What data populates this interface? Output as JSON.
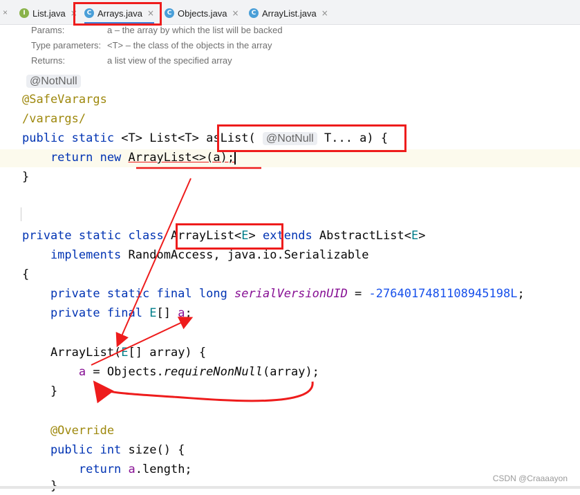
{
  "tabs": [
    {
      "label": "List.java",
      "icon": "I"
    },
    {
      "label": "Arrays.java",
      "icon": "C"
    },
    {
      "label": "Objects.java",
      "icon": "C"
    },
    {
      "label": "ArrayList.java",
      "icon": "C"
    }
  ],
  "tab_close_glyph": "×",
  "doc": {
    "params_key": "Params:",
    "params_val": "a – the array by which the list will be backed",
    "type_params_key": "Type parameters:",
    "type_params_val": "<T> – the class of the objects in the array",
    "returns_key": "Returns:",
    "returns_val": "a list view of the specified array"
  },
  "code": {
    "l1": "@NotNull",
    "l2": "@SafeVarargs",
    "l3": "/varargs/",
    "l4_a": "public static ",
    "l4_b": "<T> List<T> ",
    "l4_c": "asList(",
    "l4_hint": "@NotNull",
    "l4_d": "T... a) {",
    "l5_a": "    return new ",
    "l5_b": "ArrayList<>(a);",
    "l6": "}",
    "l7_a": "private static class ",
    "l7_b": "ArrayList<",
    "l7_c": "E",
    "l7_d": "> ",
    "l7_e": "extends ",
    "l7_f": "AbstractList<",
    "l7_g": "E",
    "l7_h": ">",
    "l8_a": "    implements ",
    "l8_b": "RandomAccess, java.io.Serializable",
    "l9": "{",
    "l10_a": "    private static final long ",
    "l10_b": "serialVersionUID",
    "l10_c": " = ",
    "l10_d": "-2764017481108945198L",
    "l10_e": ";",
    "l11_a": "    private final ",
    "l11_b": "E",
    "l11_c": "[] ",
    "l11_d": "a",
    "l11_e": ";",
    "l12_a": "    ArrayList(",
    "l12_b": "E",
    "l12_c": "[] array) {",
    "l13_a": "        ",
    "l13_b": "a",
    "l13_c": " = Objects.",
    "l13_d": "requireNonNull",
    "l13_e": "(array);",
    "l14": "    }",
    "l15": "    @Override",
    "l16_a": "    public int ",
    "l16_b": "size() {",
    "l17_a": "        return ",
    "l17_b": "a",
    "l17_c": ".length;",
    "l18": "    }"
  },
  "watermark": "CSDN @Craaaayon",
  "colors": {
    "highlight": "#ee1c1c",
    "keyword": "#0033b3",
    "annotation": "#9e880d"
  }
}
